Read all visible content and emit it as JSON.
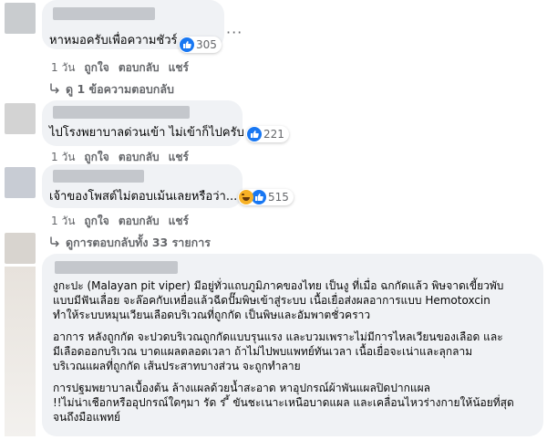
{
  "comments": [
    {
      "text": "หาหมอครับเพื่อความชัวร์",
      "reaction_count": "305",
      "time": "1 วัน",
      "like_label": "ถูกใจ",
      "reply_label": "ตอบกลับ",
      "share_label": "แชร์",
      "replies_link": "ดู 1 ข้อความตอบกลับ"
    },
    {
      "text": "ไปโรงพยาบาลด่วนเข้า ไม่เข้าก็ไปครับ",
      "reaction_count": "221",
      "time": "1 วัน",
      "like_label": "ถูกใจ",
      "reply_label": "ตอบกลับ",
      "share_label": "แชร์"
    },
    {
      "text": "เจ้าของโพสต์ไม่ตอบเม้นเลยหรือว่า...",
      "reaction_count": "515",
      "time": "1 วัน",
      "like_label": "ถูกใจ",
      "reply_label": "ตอบกลับ",
      "share_label": "แชร์",
      "replies_link": "ดูการตอบกลับทั้ง 33 รายการ"
    }
  ],
  "long_comment": {
    "p1": [
      "งูกะปะ (Malayan pit viper) มีอยู่ทั่วแถบภูมิภาคของไทย เป็นงู ที่เมื่อ ฉกกัดแล้ว พิษจาดเขี้ยวพับ",
      "แบบมีฟันเลื่อย จะล๊อคกับเหยื่อแล้วฉีดปั๊มพิษเข้าสู่ระบบ เนื้อเยื่อส่งผลอาการแบบ Hemotoxcin",
      "ทำให้ระบบหมุนเวียนเลือดบริเวณที่ถูกกัด เป็นพิษและอัมพาตชั่วคราว"
    ],
    "p2": [
      "อาการ หลังถูกกัด จะปวดบริเวณถูกกัดแบบรุนแรง และบวมเพราะไม่มีการไหลเวียนของเลือด และ",
      "มีเลือดออกบริเวณ บาดแผลตลอดเวลา ถ้าไม่ไปพบแพทย์ทันเวลา เนื้อเยื่อจะเน่าและลุกลาม",
      "บริเวณแผลที่ถูกกัด เส้นประสาทบางส่วน จะถูกทำลาย"
    ],
    "p3": [
      "การปฐมพยาบาลเบื้องต้น ล้างแผลด้วยน้ำสะอาด หาอุปกรณ์ผ้าพันแผลปิดปากแผล",
      "!!ไม่น่าเชือกหรืออุปกรณ์ใดๆมา รัด ร ี้ ขันชะเนาะเหนือบาดแผล และเคลื่อนไหวร่างกายให้น้อยที่สุด",
      "จนถึงมือแพทย์"
    ]
  }
}
